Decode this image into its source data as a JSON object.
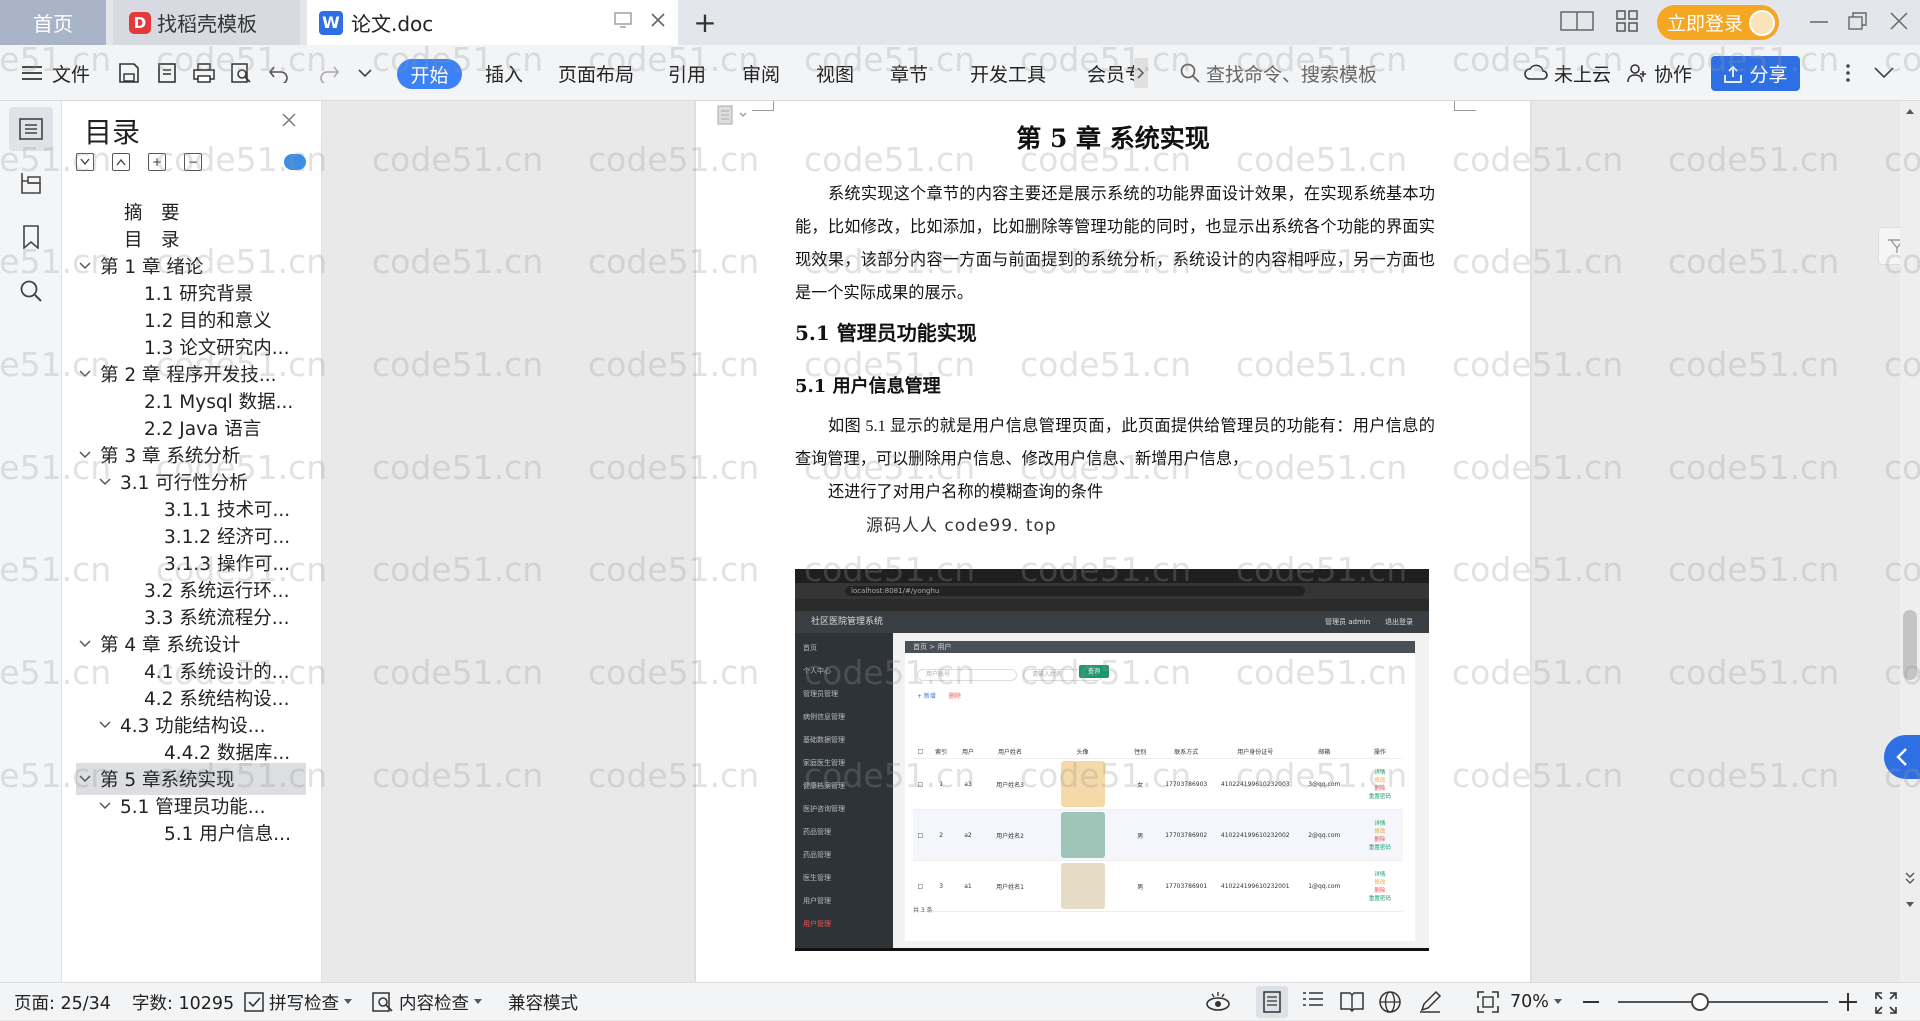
{
  "titlebar": {
    "tabs": [
      {
        "label": "首页"
      },
      {
        "label": "找稻壳模板"
      },
      {
        "label": "论文.doc"
      }
    ],
    "login_label": "立即登录"
  },
  "toolbar": {
    "file_label": "文件",
    "menu": [
      "开始",
      "插入",
      "页面布局",
      "引用",
      "审阅",
      "视图",
      "章节",
      "开发工具",
      "会员专"
    ],
    "search_placeholder": "查找命令、搜索模板",
    "cloud_label": "未上云",
    "collab_label": "协作",
    "share_label": "分享"
  },
  "toc": {
    "title": "目录",
    "items": [
      {
        "label": "摘　要"
      },
      {
        "label": "目　录"
      },
      {
        "label": "第 1 章  绪论"
      },
      {
        "label": "1.1  研究背景"
      },
      {
        "label": "1.2 目的和意义"
      },
      {
        "label": "1.3  论文研究内..."
      },
      {
        "label": "第 2 章  程序开发技..."
      },
      {
        "label": "2.1 Mysql 数据..."
      },
      {
        "label": "2.2 Java 语言"
      },
      {
        "label": "第 3 章  系统分析"
      },
      {
        "label": "3.1 可行性分析"
      },
      {
        "label": "3.1.1 技术可..."
      },
      {
        "label": "3.1.2 经济可..."
      },
      {
        "label": "3.1.3 操作可..."
      },
      {
        "label": "3.2 系统运行环..."
      },
      {
        "label": "3.3 系统流程分..."
      },
      {
        "label": "第 4 章  系统设计"
      },
      {
        "label": "4.1  系统设计的..."
      },
      {
        "label": "4.2  系统结构设..."
      },
      {
        "label": "4.3 功能结构设..."
      },
      {
        "label": "4.4.2  数据库..."
      },
      {
        "label": "第 5 章系统实现"
      },
      {
        "label": "5.1 管理员功能..."
      },
      {
        "label": "5.1 用户信息..."
      }
    ]
  },
  "document": {
    "chapter_title": "第 5 章  系统实现",
    "intro": "系统实现这个章节的内容主要还是展示系统的功能界面设计效果，在实现系统基本功能，比如修改，比如添加，比如删除等管理功能的同时，也显示出系统各个功能的界面实现效果，该部分内容一方面与前面提到的系统分析，系统设计的内容相呼应，另一方面也是一个实际成果的展示。",
    "section_h2": "5.1 管理员功能实现",
    "section_h3": "5.1 用户信息管理",
    "body_p1": "如图 5.1 显示的就是用户信息管理页面，此页面提供给管理员的功能有：用户信息的查询管理，可以删除用户信息、修改用户信息、新增用户信息，",
    "body_p2": "还进行了对用户名称的模糊查询的条件",
    "overlay_source": "源码人人   code99. top",
    "figure": {
      "url": "localhost:8081/#/yonghu",
      "app_title": "社区医院管理系统",
      "user_text": "管理员 admin",
      "logout": "退出登录",
      "breadcrumb": "首页 > 用户",
      "search_placeholder_1": "用户账号",
      "search_placeholder_2": "请输入姓名",
      "search_btn": "查询",
      "add_btn": "+ 新增",
      "del_btn": "删除",
      "menu": [
        "首页",
        "个人中心",
        "管理员管理",
        "病例信息管理",
        "基础数据管理",
        "家庭医生管理",
        "健康档案管理",
        "医护咨询管理",
        "药品管理",
        "药品管理",
        "医生管理",
        "用户管理",
        "用户管理"
      ],
      "headers": [
        "索引",
        "用户",
        "用户姓名",
        "头像",
        "性别",
        "联系方式",
        "用户身份证号",
        "邮箱",
        "操作"
      ],
      "rows": [
        {
          "idx": "1",
          "acc": "a3",
          "name": "用户姓名3",
          "sex": "女",
          "phone": "17703786903",
          "id": "410224199610232003",
          "mail": "3@qq.com"
        },
        {
          "idx": "2",
          "acc": "a2",
          "name": "用户姓名2",
          "sex": "男",
          "phone": "17703786902",
          "id": "410224199610232002",
          "mail": "2@qq.com"
        },
        {
          "idx": "3",
          "acc": "a1",
          "name": "用户姓名1",
          "sex": "男",
          "phone": "17703786901",
          "id": "410224199610232001",
          "mail": "1@qq.com"
        }
      ],
      "ops": [
        "详情",
        "修改",
        "删除",
        "重置密码"
      ],
      "pager": "共 3 条"
    }
  },
  "statusbar": {
    "page": "页面: 25/34",
    "words": "字数: 10295",
    "spell": "拼写检查",
    "content": "内容检查",
    "compat": "兼容模式",
    "zoom": "70%",
    "zoom_level": 0.7
  },
  "watermark": "code51.cn",
  "colors": {
    "accent": "#2f6fe4",
    "login": "#f5a623"
  }
}
